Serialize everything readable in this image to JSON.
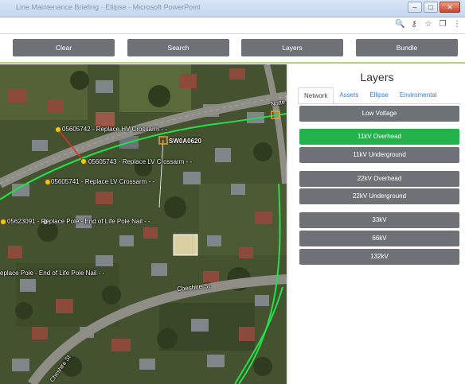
{
  "window": {
    "title": "Line Maintenance Briefing · Ellipse · Microsoft PowerPoint",
    "minimize_glyph": "–",
    "maximize_glyph": "□",
    "close_glyph": "✕"
  },
  "addressbar": {
    "icons": [
      "zoom-icon",
      "key-icon",
      "star-icon",
      "extension-icon",
      "menu-icon"
    ],
    "glyphs": {
      "zoom": "🔍",
      "key": "⚷",
      "star": "☆",
      "extension": "❐",
      "menu": "⋮"
    }
  },
  "toolbar": {
    "clear_label": "Clear",
    "search_label": "Search",
    "layers_label": "Layers",
    "bundle_label": "Bundle"
  },
  "map": {
    "labels": [
      "05605742 - Replace HV Crossarm - -",
      "SW0A0620",
      "05605743 - Replace LV Crossarm - -",
      "05605741 - Replace LV Crossarm - -",
      "05623091 - Replace Pole - End of Life Pole Nail - -",
      "eplace Pole - End of Life Pole Nail - -",
      "Cheshire St",
      "Cheshire St",
      "Notte"
    ]
  },
  "panel": {
    "title": "Layers",
    "tabs": [
      "Network",
      "Assets",
      "Ellipse",
      "Enviromental"
    ],
    "active_tab": "Network",
    "layers": [
      {
        "label": "Low Voltage",
        "active": false
      },
      {
        "label": "11kV Overhead",
        "active": true
      },
      {
        "label": "11kV Underground",
        "active": false
      },
      {
        "label": "22kV Overhead",
        "active": false
      },
      {
        "label": "22kV Underground",
        "active": false
      },
      {
        "label": "33kV",
        "active": false
      },
      {
        "label": "66kV",
        "active": false
      },
      {
        "label": "132kV",
        "active": false
      }
    ]
  },
  "colors": {
    "button_gray": "#6e7276",
    "active_green": "#23b24b",
    "accent_line": "#b4cf7a",
    "overhead_line": "#22e04a",
    "tab_link": "#3a7ad8"
  }
}
